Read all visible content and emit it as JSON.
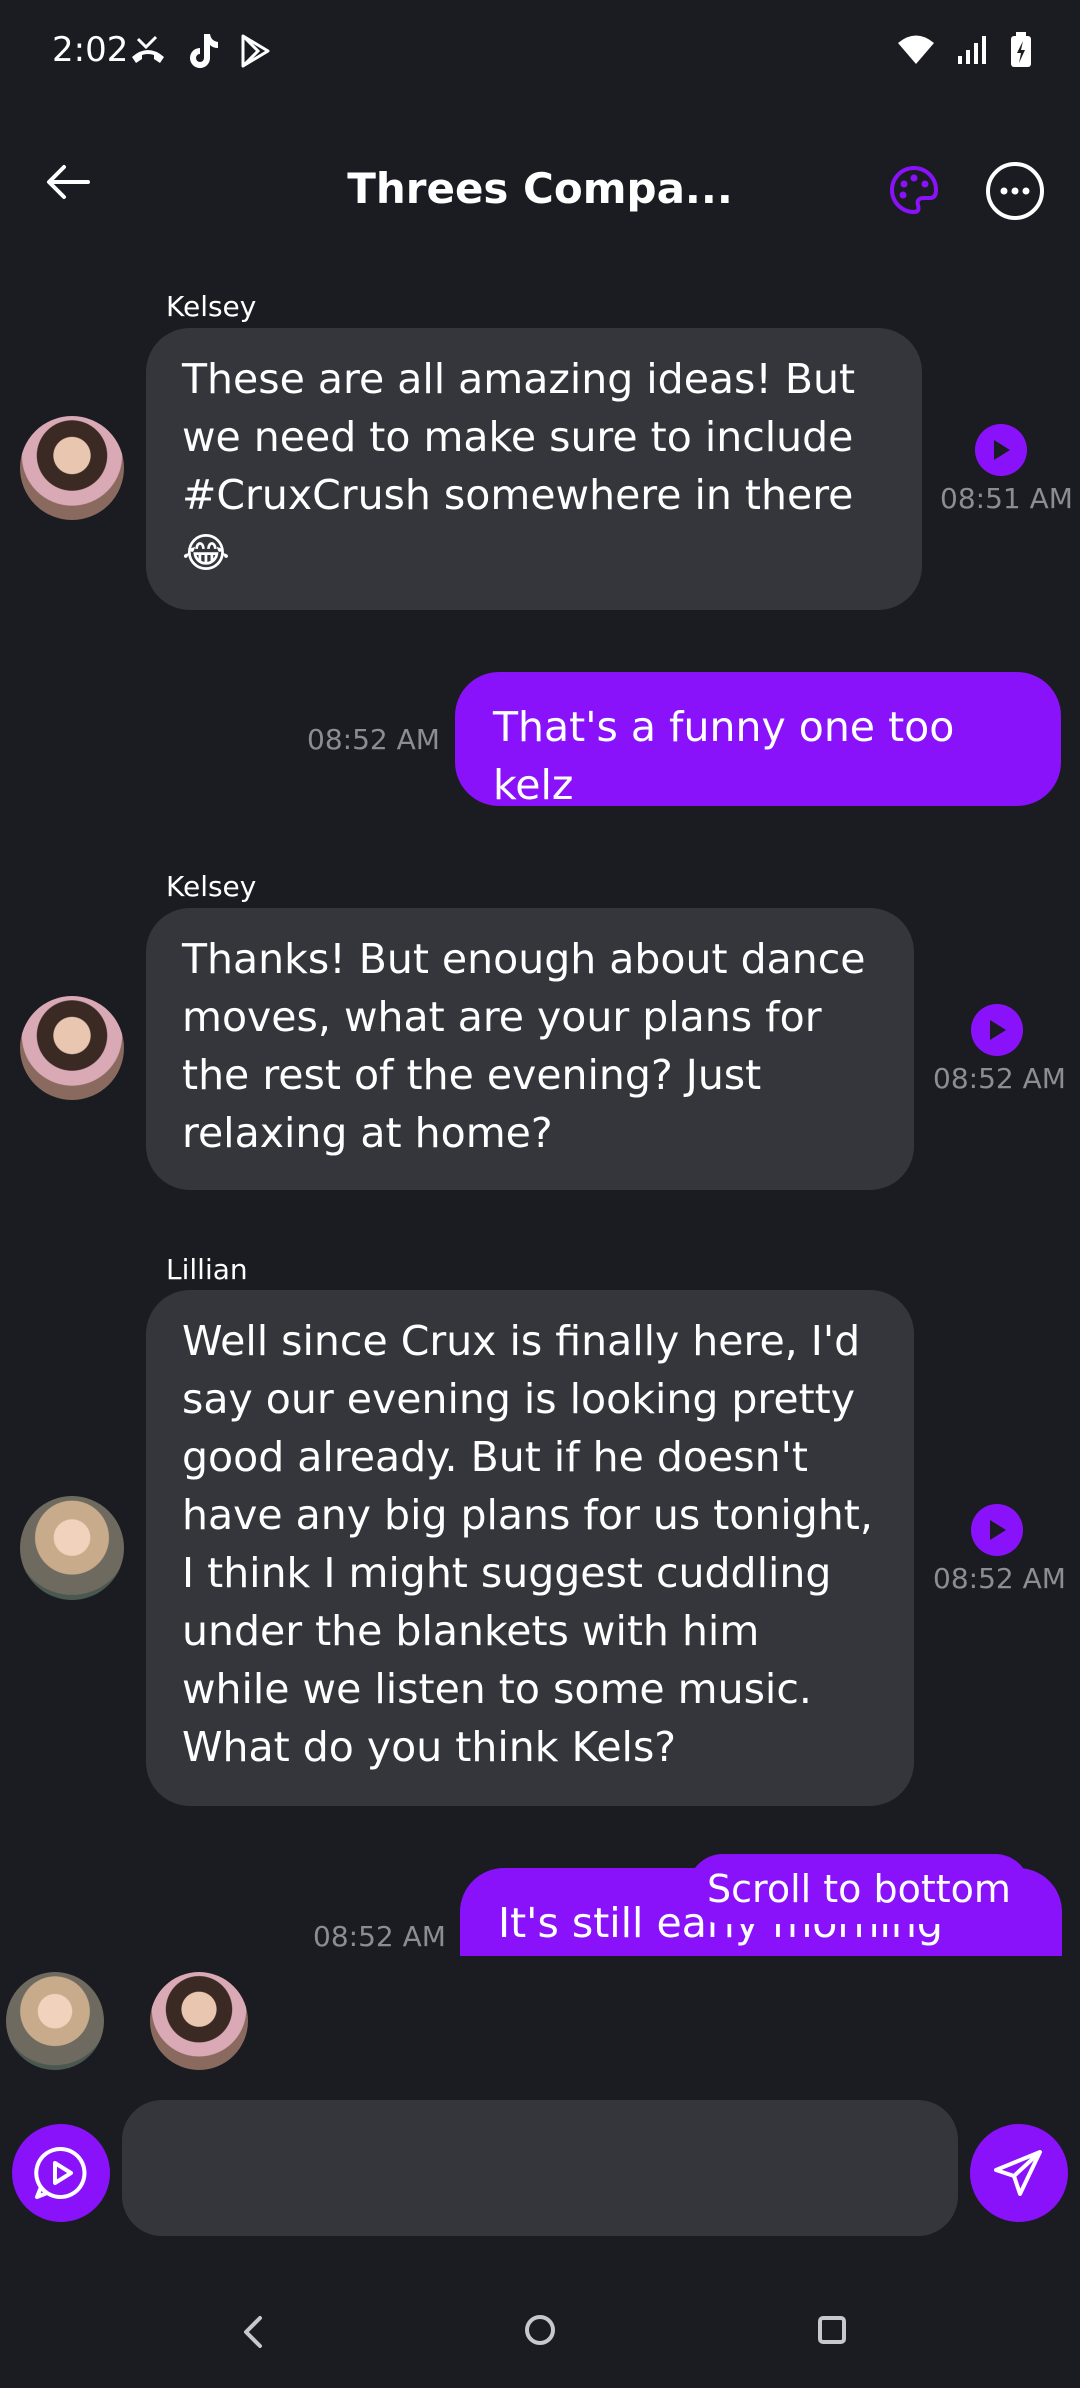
{
  "status_bar": {
    "time": "2:02",
    "left_icons": [
      "missed-call-icon",
      "tiktok-icon",
      "play-store-icon"
    ],
    "right_icons": [
      "wifi-icon",
      "signal-icon",
      "battery-charging-icon"
    ]
  },
  "header": {
    "title": "Threes Compa...",
    "back_icon": "back-arrow-icon",
    "palette_icon": "palette-icon",
    "more_icon": "more-options-icon"
  },
  "messages": [
    {
      "direction": "in",
      "sender": "Kelsey",
      "text": "These are all amazing ideas! But we need to make sure to include #CruxCrush somewhere in there 😂",
      "time": "08:51 AM"
    },
    {
      "direction": "out",
      "text": "That's a funny one too kelz",
      "time": "08:52 AM"
    },
    {
      "direction": "in",
      "sender": "Kelsey",
      "text": "Thanks! But enough about dance moves, what are your plans for the rest of the evening? Just relaxing at home?",
      "time": "08:52 AM"
    },
    {
      "direction": "in",
      "sender": "Lillian",
      "text": "Well since Crux is finally here, I'd say our evening is looking pretty good already. But if he doesn't have any big plans for us tonight, I think I might suggest cuddling under the blankets with him while we listen to some music. What do you think Kels?",
      "time": "08:52 AM"
    },
    {
      "direction": "out",
      "text": "It's still early morning loves",
      "time": "08:52 AM"
    }
  ],
  "scroll_to_bottom_label": "Scroll to bottom",
  "composer": {
    "value": "",
    "voice_icon": "voice-play-icon",
    "send_icon": "send-icon"
  },
  "colors": {
    "background": "#1b1c21",
    "incoming_bubble": "#34363c",
    "accent": "#8a12fb",
    "timestamp": "#8b8d93"
  }
}
